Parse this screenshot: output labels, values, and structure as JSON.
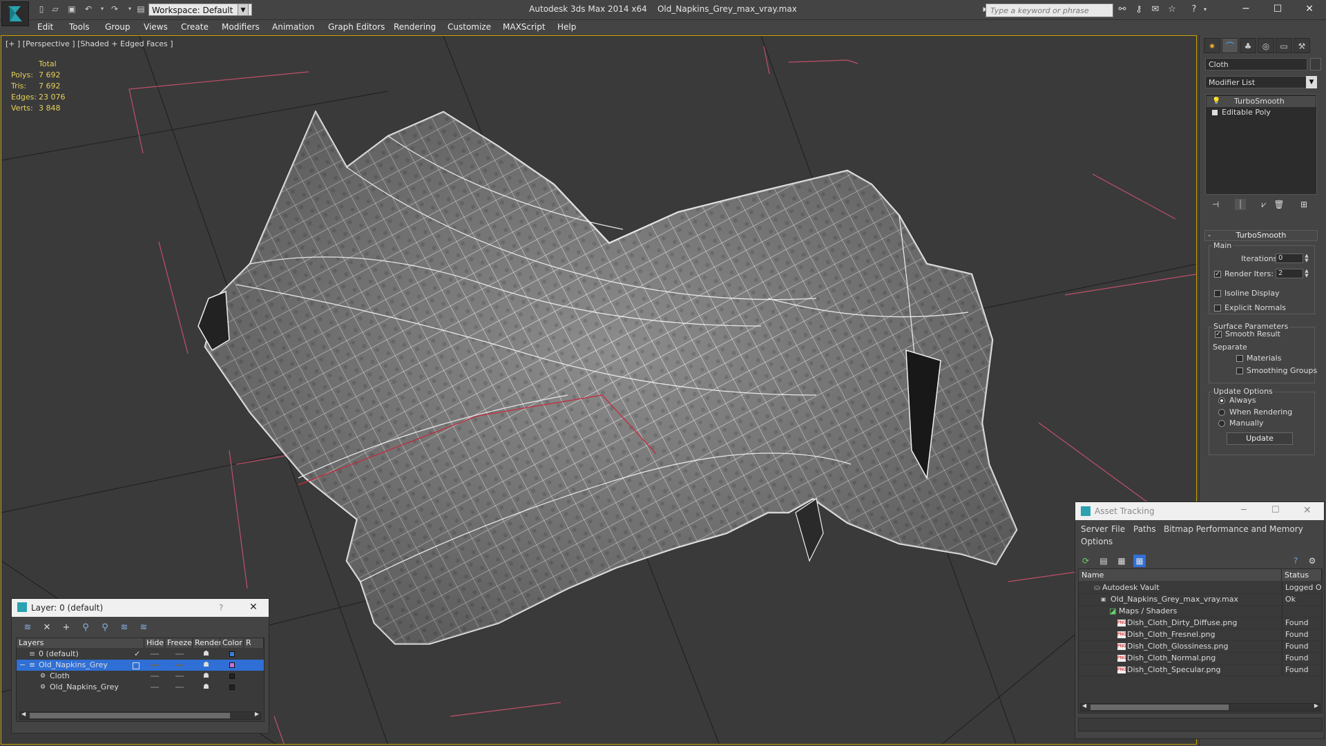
{
  "app": {
    "title": "Autodesk 3ds Max  2014 x64",
    "file": "Old_Napkins_Grey_max_vray.max",
    "workspace": "Workspace: Default",
    "search_placeholder": "Type a keyword or phrase"
  },
  "menu": [
    "Edit",
    "Tools",
    "Group",
    "Views",
    "Create",
    "Modifiers",
    "Animation",
    "Graph Editors",
    "Rendering",
    "Customize",
    "MAXScript",
    "Help"
  ],
  "viewport": {
    "label": "[+ ] [Perspective ] [Shaded + Edged Faces ]",
    "stats": {
      "header": "Total",
      "polys_label": "Polys:",
      "polys": "7 692",
      "tris_label": "Tris:",
      "tris": "7 692",
      "edges_label": "Edges:",
      "edges": "23 076",
      "verts_label": "Verts:",
      "verts": "3 848"
    }
  },
  "command_panel": {
    "object_name": "Cloth",
    "modifier_list": "Modifier List",
    "stack": [
      "TurboSmooth",
      "Editable Poly"
    ],
    "rollout_title": "TurboSmooth",
    "main_label": "Main",
    "iterations_label": "Iterations:",
    "iterations": "0",
    "render_iters_label": "Render Iters:",
    "render_iters": "2",
    "render_iters_checked": true,
    "isoline_label": "Isoline Display",
    "explicit_normals_label": "Explicit Normals",
    "surface_label": "Surface Parameters",
    "smooth_result_label": "Smooth Result",
    "separate_label": "Separate",
    "materials_label": "Materials",
    "smoothing_groups_label": "Smoothing Groups",
    "update_options_label": "Update Options",
    "always_label": "Always",
    "when_rendering_label": "When Rendering",
    "manually_label": "Manually",
    "update_button": "Update"
  },
  "layer_window": {
    "title": "Layer: 0 (default)",
    "help": "?",
    "columns": [
      "Layers",
      "Hide",
      "Freeze",
      "Render",
      "Color",
      "R"
    ],
    "rows": [
      {
        "name": "0 (default)",
        "color": "#3a7fd8"
      },
      {
        "name": "Old_Napkins_Grey",
        "color": "#d070d0"
      },
      {
        "name": "Cloth",
        "color": "#222222"
      },
      {
        "name": "Old_Napkins_Grey",
        "color": "#222222"
      }
    ]
  },
  "asset_window": {
    "title": "Asset Tracking",
    "menu": [
      "Server",
      "File",
      "Paths",
      "Bitmap Performance and Memory",
      "Options"
    ],
    "columns": [
      "Name",
      "Status"
    ],
    "rows": [
      {
        "name": "Autodesk Vault",
        "status": "Logged O"
      },
      {
        "name": "Old_Napkins_Grey_max_vray.max",
        "status": "Ok"
      },
      {
        "name": "Maps / Shaders",
        "status": ""
      },
      {
        "name": "Dish_Cloth_Dirty_Diffuse.png",
        "status": "Found"
      },
      {
        "name": "Dish_Cloth_Fresnel.png",
        "status": "Found"
      },
      {
        "name": "Dish_Cloth_Glossiness.png",
        "status": "Found"
      },
      {
        "name": "Dish_Cloth_Normal.png",
        "status": "Found"
      },
      {
        "name": "Dish_Cloth_Specular.png",
        "status": "Found"
      }
    ]
  },
  "colors": {
    "accent": "#c8a000",
    "stats": "#e6d15a",
    "selection": "#2f6fd6"
  }
}
